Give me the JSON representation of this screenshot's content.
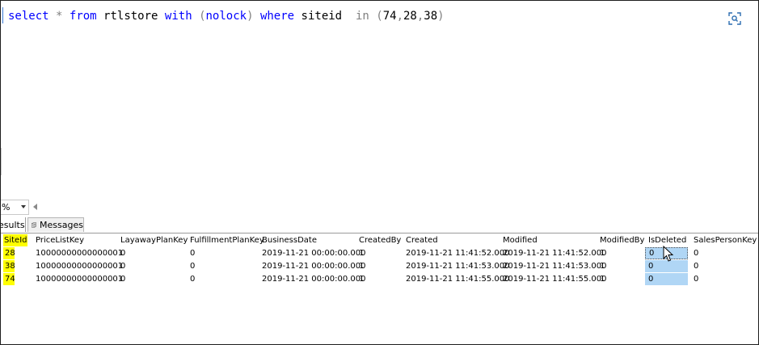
{
  "query": {
    "tokens": [
      {
        "text": "select",
        "cls": "kw"
      },
      {
        "text": " ",
        "cls": "id"
      },
      {
        "text": "*",
        "cls": "gray"
      },
      {
        "text": " ",
        "cls": "id"
      },
      {
        "text": "from",
        "cls": "kw"
      },
      {
        "text": " rtlstore ",
        "cls": "id"
      },
      {
        "text": "with",
        "cls": "kw"
      },
      {
        "text": " ",
        "cls": "id"
      },
      {
        "text": "(",
        "cls": "gray"
      },
      {
        "text": "nolock",
        "cls": "kw"
      },
      {
        "text": ")",
        "cls": "gray"
      },
      {
        "text": " ",
        "cls": "id"
      },
      {
        "text": "where",
        "cls": "kw"
      },
      {
        "text": " siteid  ",
        "cls": "id"
      },
      {
        "text": "in",
        "cls": "gray"
      },
      {
        "text": " ",
        "cls": "id"
      },
      {
        "text": "(",
        "cls": "gray"
      },
      {
        "text": "74",
        "cls": "id"
      },
      {
        "text": ",",
        "cls": "gray"
      },
      {
        "text": "28",
        "cls": "id"
      },
      {
        "text": ",",
        "cls": "gray"
      },
      {
        "text": "38",
        "cls": "id"
      },
      {
        "text": ")",
        "cls": "gray"
      }
    ]
  },
  "zoom": {
    "value": "%"
  },
  "tabs": {
    "results_label": "esults",
    "messages_label": "Messages"
  },
  "grid": {
    "columns": [
      "SiteId",
      "PriceListKey",
      "LayawayPlanKey",
      "FulfillmentPlanKey",
      "BusinessDate",
      "CreatedBy",
      "Created",
      "Modified",
      "ModifiedBy",
      "IsDeleted",
      "SalesPersonKey"
    ],
    "rows": [
      [
        "28",
        "10000000000000001",
        "0",
        "0",
        "2019-11-21 00:00:00.000",
        "1",
        "2019-11-21 11:41:52.000",
        "2019-11-21 11:41:52.000",
        "1",
        "0",
        "0"
      ],
      [
        "38",
        "10000000000000001",
        "0",
        "0",
        "2019-11-21 00:00:00.000",
        "1",
        "2019-11-21 11:41:53.000",
        "2019-11-21 11:41:53.000",
        "1",
        "0",
        "0"
      ],
      [
        "74",
        "10000000000000001",
        "0",
        "0",
        "2019-11-21 00:00:00.000",
        "1",
        "2019-11-21 11:41:55.000",
        "2019-11-21 11:41:55.000",
        "1",
        "0",
        "0"
      ]
    ]
  },
  "colors": {
    "keyword": "#0000ff",
    "operator": "#808080",
    "siteid_highlight": "#ffff00",
    "selection": "#b0d6f5"
  },
  "icons": [
    "lens-icon",
    "messages-icon",
    "dropdown-arrow-icon",
    "scroll-left-arrow-icon",
    "mouse-cursor-icon"
  ]
}
